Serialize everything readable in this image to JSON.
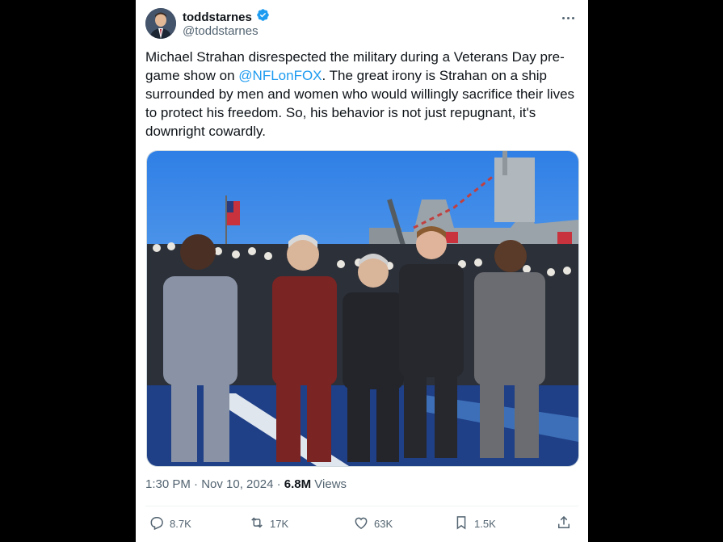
{
  "post": {
    "author": {
      "display_name": "toddstarnes",
      "handle": "@toddstarnes",
      "verified": true,
      "verified_color": "#1d9bf0"
    },
    "text_before": "Michael Strahan disrespected the military during a Veterans Day pre-game show on ",
    "mention": "@NFLonFOX",
    "text_after": ". The great irony is Strahan on a ship surrounded by men and women who would willingly sacrifice their lives to protect his freedom. So, his behavior is not just repugnant, it's downright cowardly.",
    "timestamp": "1:30 PM · Nov 10, 2024 · ",
    "views_count": "6.8M",
    "views_label": " Views"
  },
  "actions": {
    "replies": "8.7K",
    "reposts": "17K",
    "likes": "63K",
    "bookmarks": "1.5K"
  },
  "icons": [
    "verified-badge-icon",
    "more-icon",
    "reply-icon",
    "repost-icon",
    "like-icon",
    "bookmark-icon",
    "share-icon"
  ],
  "colors": {
    "accent": "#1d9bf0",
    "text": "#0f1419",
    "muted": "#536471",
    "background": "#000000"
  }
}
